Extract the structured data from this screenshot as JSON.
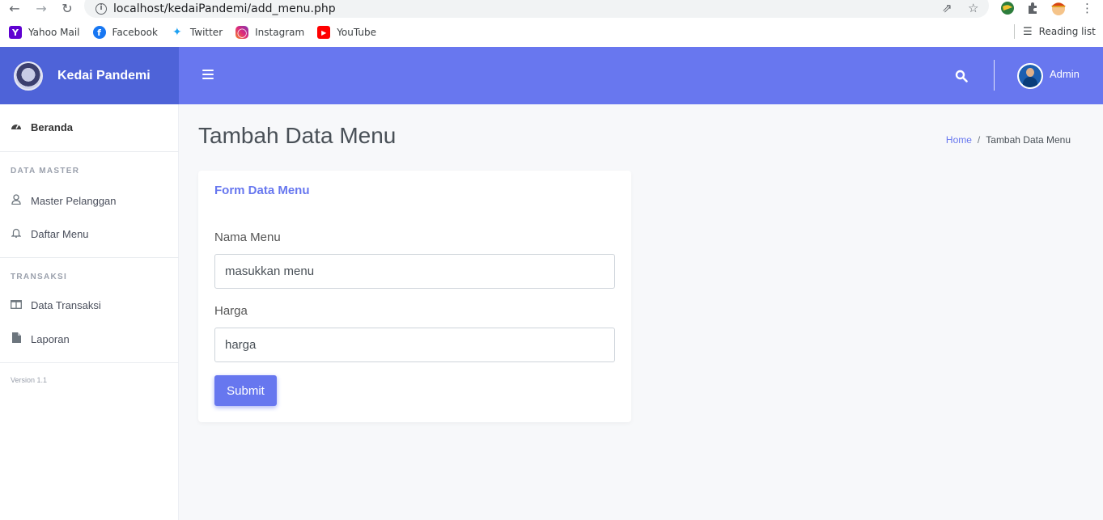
{
  "browser": {
    "url": "localhost/kedaiPandemi/add_menu.php",
    "bookmarks": [
      "Yahoo Mail",
      "Facebook",
      "Twitter",
      "Instagram",
      "YouTube"
    ],
    "reading_list": "Reading list"
  },
  "brand": {
    "name": "Kedai Pandemi"
  },
  "topbar": {
    "user": "Admin"
  },
  "sidebar": {
    "dashboard": "Beranda",
    "section_master": "DATA MASTER",
    "item_pelanggan": "Master Pelanggan",
    "item_menu": "Daftar Menu",
    "section_transaksi": "TRANSAKSI",
    "item_transaksi": "Data Transaksi",
    "item_laporan": "Laporan",
    "version": "Version 1.1"
  },
  "page": {
    "title": "Tambah Data Menu",
    "breadcrumb_home": "Home",
    "breadcrumb_sep": "/",
    "breadcrumb_current": "Tambah Data Menu"
  },
  "form": {
    "title": "Form Data Menu",
    "nama_label": "Nama Menu",
    "nama_placeholder": "masukkan menu",
    "harga_label": "Harga",
    "harga_placeholder": "harga",
    "submit": "Submit"
  },
  "colors": {
    "primary": "#6777ef",
    "brand_dark": "#4e63d8"
  }
}
